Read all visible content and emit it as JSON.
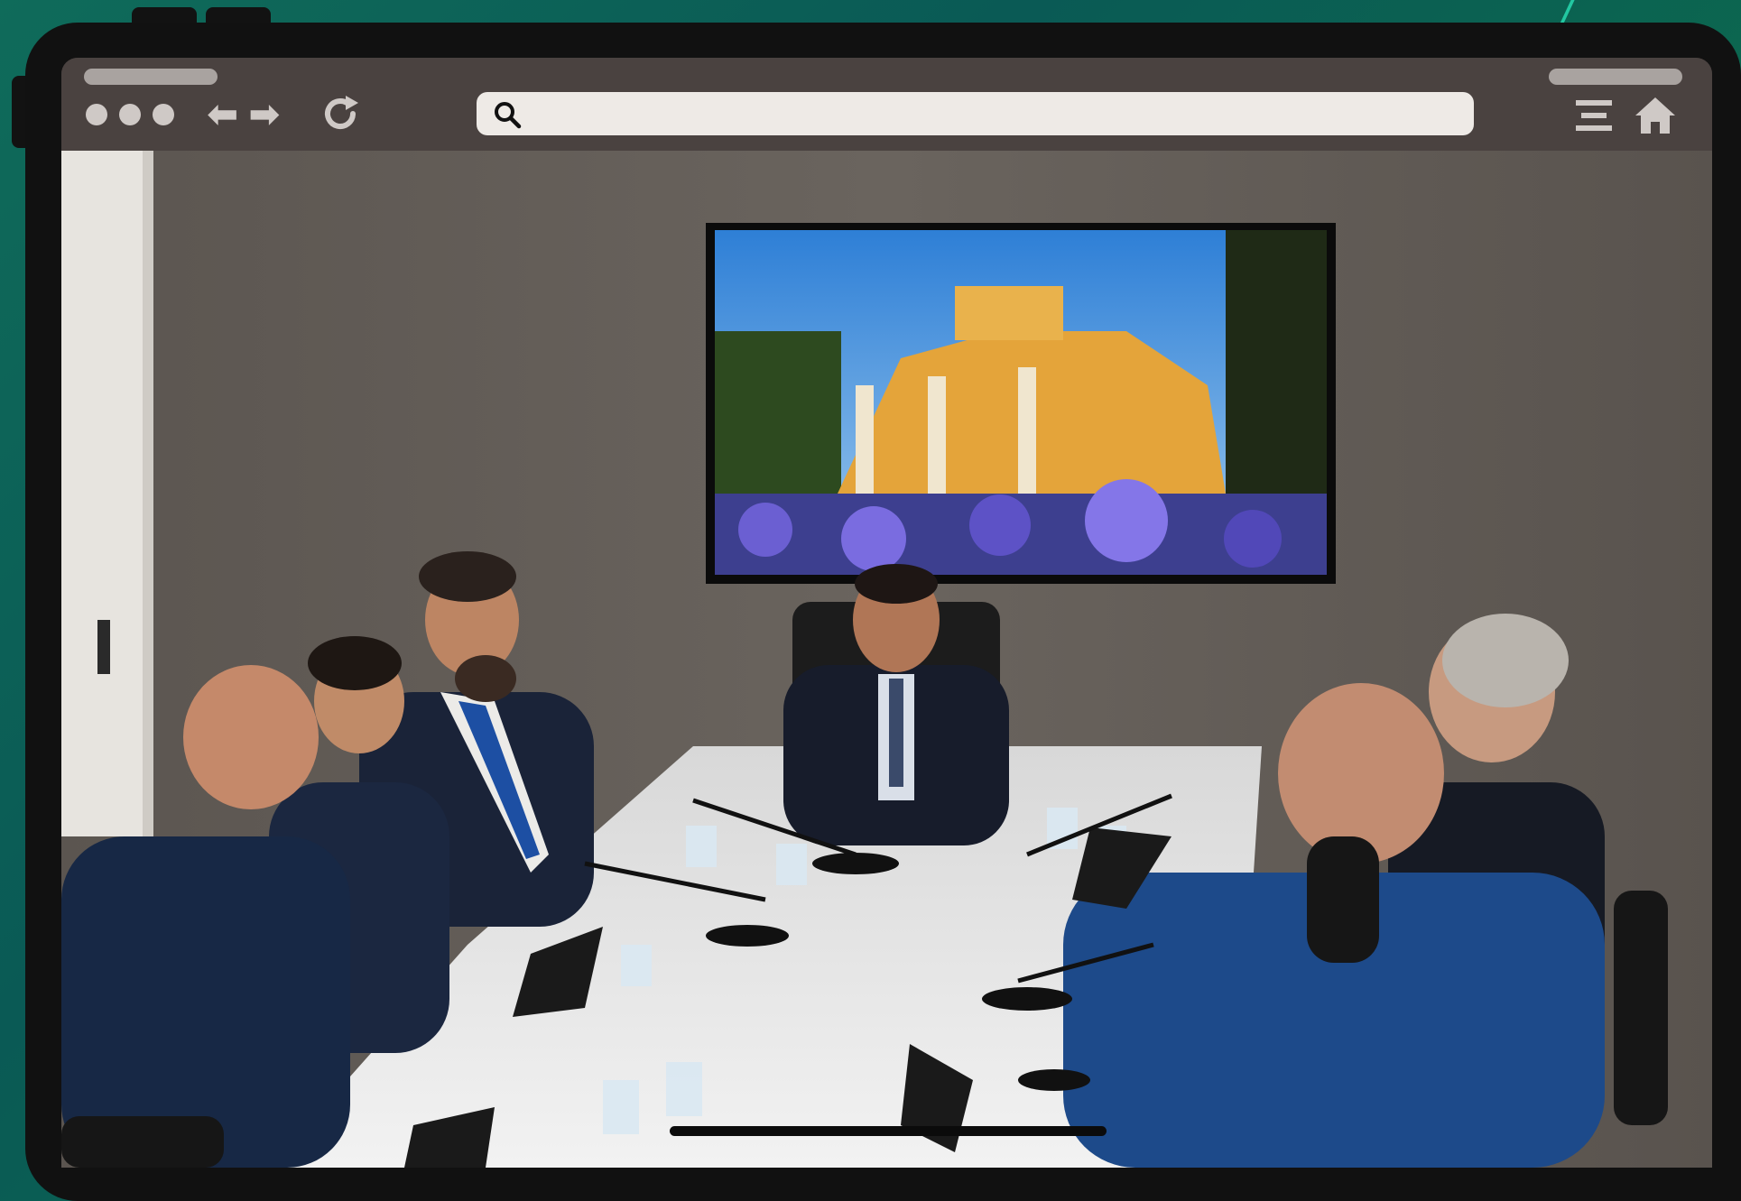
{
  "browser": {
    "search": {
      "placeholder": "",
      "value": ""
    },
    "icons": {
      "window_controls": "dots-icon",
      "back": "arrow-left-icon",
      "forward": "arrow-right-icon",
      "reload": "reload-icon",
      "search": "search-icon",
      "menu": "menu-icon",
      "home": "home-icon"
    },
    "nav_glyphs": {
      "back": "⬅",
      "forward": "➡"
    }
  },
  "colors": {
    "background": "#0f6b5a",
    "device_frame": "#111111",
    "toolbar": "#4a4240",
    "toolbar_glyph": "#cfc9c6",
    "search_field": "#eeeae6"
  }
}
